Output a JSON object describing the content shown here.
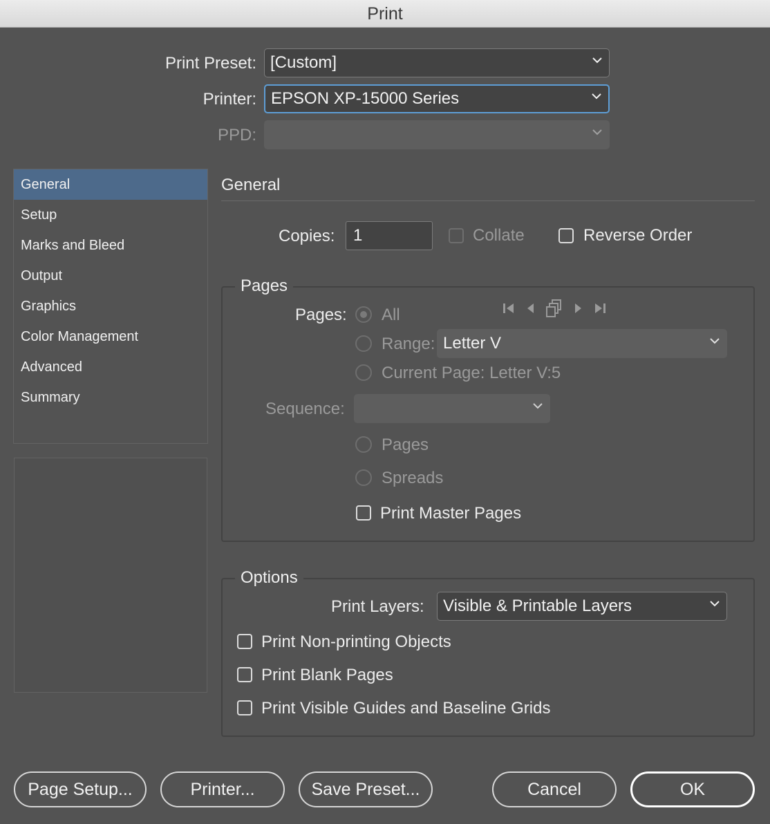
{
  "window": {
    "title": "Print"
  },
  "top": {
    "preset_label": "Print Preset:",
    "preset_value": "[Custom]",
    "printer_label": "Printer:",
    "printer_value": "EPSON XP-15000 Series",
    "ppd_label": "PPD:",
    "ppd_value": ""
  },
  "sidebar": {
    "items": [
      {
        "label": "General",
        "active": true
      },
      {
        "label": "Setup"
      },
      {
        "label": "Marks and Bleed"
      },
      {
        "label": "Output"
      },
      {
        "label": "Graphics"
      },
      {
        "label": "Color Management"
      },
      {
        "label": "Advanced"
      },
      {
        "label": "Summary"
      }
    ]
  },
  "general": {
    "heading": "General",
    "copies_label": "Copies:",
    "copies_value": "1",
    "collate_label": "Collate",
    "reverse_label": "Reverse Order"
  },
  "pages": {
    "group_title": "Pages",
    "pages_label": "Pages:",
    "all_label": "All",
    "range_label": "Range:",
    "range_value": "Letter V",
    "current_label": "Current Page: Letter V:5",
    "sequence_label": "Sequence:",
    "sequence_value": "",
    "seq_pages_label": "Pages",
    "seq_spreads_label": "Spreads",
    "master_label": "Print Master Pages"
  },
  "options": {
    "group_title": "Options",
    "layers_label": "Print Layers:",
    "layers_value": "Visible & Printable Layers",
    "nonprinting_label": "Print Non-printing Objects",
    "blank_label": "Print Blank Pages",
    "guides_label": "Print Visible Guides and Baseline Grids"
  },
  "buttons": {
    "page_setup": "Page Setup...",
    "printer": "Printer...",
    "save_preset": "Save Preset...",
    "cancel": "Cancel",
    "ok": "OK"
  },
  "colors": {
    "background": "#535353",
    "selection": "#4d6a8b",
    "focus_ring": "#5e9ed6"
  }
}
